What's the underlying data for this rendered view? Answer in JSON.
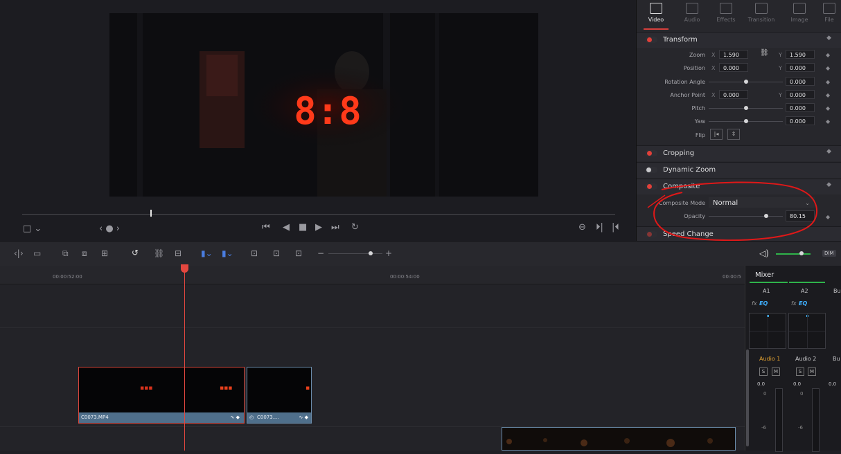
{
  "viewer": {
    "transport": [
      "⏮",
      "◀",
      "■",
      "▶",
      "⏭",
      "↻"
    ],
    "left_controls": {
      "frame_icon": "□ ⌄",
      "nav": "‹ ● ›"
    },
    "right_controls": [
      "⊖",
      "⏵|",
      "|⏴"
    ],
    "display_text": "8:8"
  },
  "inspector": {
    "tabs": [
      {
        "label": "Video",
        "icon": "film-icon"
      },
      {
        "label": "Audio",
        "icon": "music-icon"
      },
      {
        "label": "Effects",
        "icon": "wand-icon"
      },
      {
        "label": "Transition",
        "icon": "transition-icon"
      },
      {
        "label": "Image",
        "icon": "image-icon"
      },
      {
        "label": "File",
        "icon": "file-icon"
      }
    ],
    "transform": {
      "title": "Transform",
      "zoom": {
        "label": "Zoom",
        "x_axis": "X",
        "x": "1.590",
        "y_axis": "Y",
        "y": "1.590"
      },
      "position": {
        "label": "Position",
        "x_axis": "X",
        "x": "0.000",
        "y_axis": "Y",
        "y": "0.000"
      },
      "rotation": {
        "label": "Rotation Angle",
        "value": "0.000"
      },
      "anchor": {
        "label": "Anchor Point",
        "x_axis": "X",
        "x": "0.000",
        "y_axis": "Y",
        "y": "0.000"
      },
      "pitch": {
        "label": "Pitch",
        "value": "0.000"
      },
      "yaw": {
        "label": "Yaw",
        "value": "0.000"
      },
      "flip": {
        "label": "Flip"
      }
    },
    "cropping": {
      "title": "Cropping"
    },
    "dynamic_zoom": {
      "title": "Dynamic Zoom"
    },
    "composite": {
      "title": "Composite",
      "mode_label": "Composite Mode",
      "mode_value": "Normal",
      "opacity_label": "Opacity",
      "opacity_value": "80.15"
    },
    "speed_change": {
      "title": "Speed Change"
    }
  },
  "timeline": {
    "timecodes": [
      "00:00:52:00",
      "00:00:54:00",
      "00:00:5"
    ],
    "clips": [
      {
        "name": "C0073.MP4"
      },
      {
        "name": "C0073...."
      }
    ],
    "volume_badge": "DIM"
  },
  "mixer": {
    "title": "Mixer",
    "channels": [
      {
        "id": "A1",
        "name": "Audio 1",
        "level": "0.0"
      },
      {
        "id": "A2",
        "name": "Audio 2",
        "level": "0.0"
      },
      {
        "id": "Bu",
        "name": "Bu",
        "level": "0.0"
      }
    ],
    "fx": "fx",
    "eq": "EQ",
    "solo": "S",
    "mute": "M",
    "scale_zero": "0",
    "scale_minus": "-6"
  },
  "colors": {
    "accent": "#e0403a",
    "clip_bar": "#4f6f8b",
    "playhead": "#e4473f",
    "annotation": "#e01818"
  }
}
